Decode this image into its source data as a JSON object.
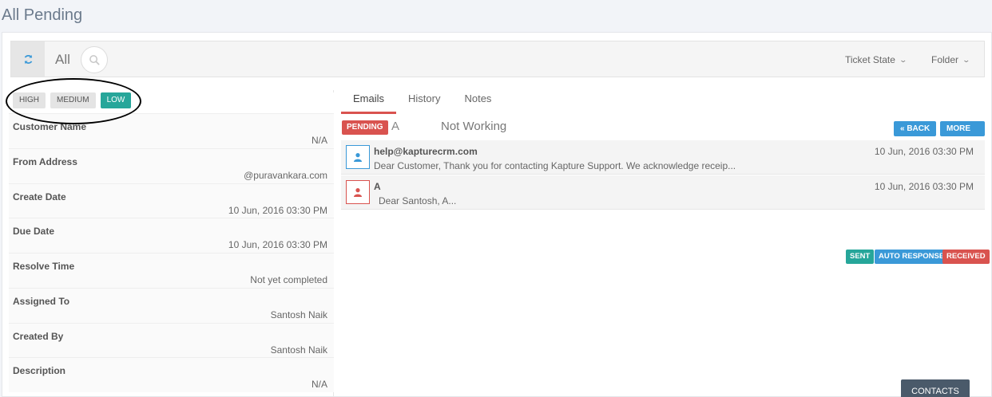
{
  "page": {
    "title": "All Pending"
  },
  "toolbar": {
    "filter_label": "All",
    "ticket_state_label": "Ticket State",
    "folder_label": "Folder",
    "refresh_icon": "refresh-icon",
    "search_icon": "search-icon"
  },
  "priority": {
    "high": "HIGH",
    "medium": "MEDIUM",
    "low": "LOW"
  },
  "details": {
    "customer_name": {
      "label": "Customer Name",
      "value": "N/A"
    },
    "from_address": {
      "label": "From Address",
      "value": "@puravankara.com"
    },
    "create_date": {
      "label": "Create Date",
      "value": "10 Jun, 2016 03:30 PM"
    },
    "due_date": {
      "label": "Due Date",
      "value": "10 Jun, 2016 03:30 PM"
    },
    "resolve_time": {
      "label": "Resolve Time",
      "value": "Not yet completed"
    },
    "assigned_to": {
      "label": "Assigned To",
      "value": "Santosh Naik"
    },
    "created_by": {
      "label": "Created By",
      "value": "Santosh Naik"
    },
    "description": {
      "label": "Description",
      "value": "N/A"
    }
  },
  "tabs": {
    "emails": "Emails",
    "history": "History",
    "notes": "Notes"
  },
  "ticket": {
    "status_badge": "PENDING",
    "subject_prefix": "A",
    "subject": "Not Working",
    "back_label": "« BACK",
    "more_label": "MORE ⌄"
  },
  "emails": [
    {
      "from": "help@kapturecrm.com",
      "preview": "Dear Customer, Thank you for contacting Kapture Support. We acknowledge receip...",
      "date": "10 Jun, 2016 03:30 PM",
      "color": "#3a99d8"
    },
    {
      "from": "A",
      "preview": "Dear Santosh,      A...",
      "date": "10 Jun, 2016 03:30 PM",
      "color": "#d9534f"
    }
  ],
  "legend": {
    "sent": "SENT",
    "auto_response": "AUTO RESPONSE",
    "received": "RECEIVED"
  },
  "colors": {
    "sent": "#26a69a",
    "auto_response": "#3a99d8",
    "received": "#d9534f",
    "pending": "#d9534f"
  },
  "footer": {
    "contacts_label": "CONTACTS"
  }
}
